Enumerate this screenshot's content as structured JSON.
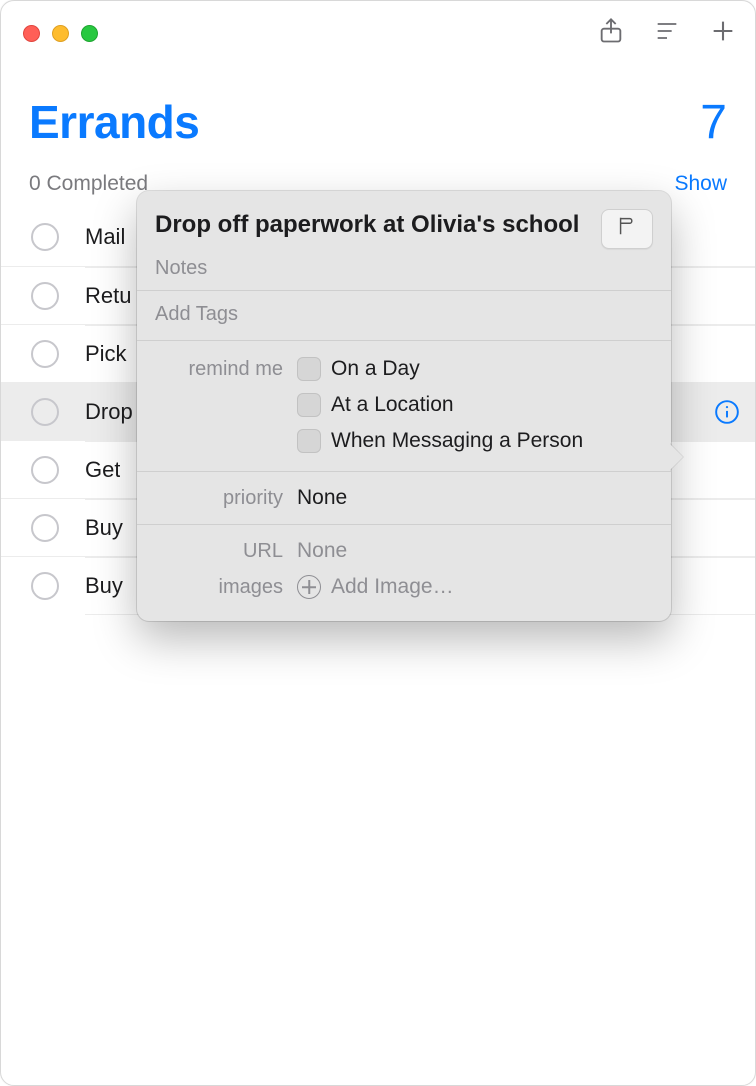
{
  "header": {
    "list_title": "Errands",
    "count": "7",
    "completed_text": "0 Completed",
    "show_link": "Show"
  },
  "reminders": [
    {
      "title": "Mail"
    },
    {
      "title": "Retu"
    },
    {
      "title": "Pick"
    },
    {
      "title": "Drop"
    },
    {
      "title": "Get"
    },
    {
      "title": "Buy"
    },
    {
      "title": "Buy"
    }
  ],
  "selected_index": 3,
  "popover": {
    "title": "Drop off paperwork at Olivia's school",
    "notes_placeholder": "Notes",
    "tags_placeholder": "Add Tags",
    "remind_me_label": "remind me",
    "remind_me_options": {
      "on_a_day": "On a Day",
      "at_a_location": "At a Location",
      "when_messaging": "When Messaging a Person"
    },
    "priority_label": "priority",
    "priority_value": "None",
    "url_label": "URL",
    "url_value": "None",
    "images_label": "images",
    "add_image_label": "Add Image…"
  }
}
